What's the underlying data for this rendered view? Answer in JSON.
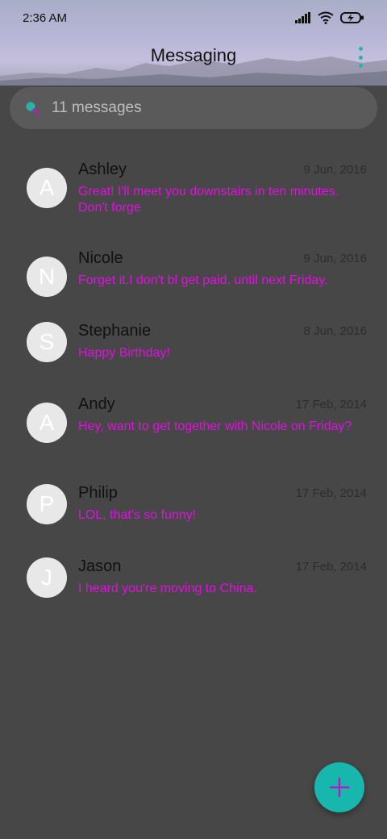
{
  "status_bar": {
    "time": "2:36 AM",
    "icons": [
      "signal-icon",
      "wifi-icon",
      "battery-charging-icon"
    ]
  },
  "app_bar": {
    "title": "Messaging",
    "menu_icon": "more-vert-icon"
  },
  "search": {
    "placeholder": "11 messages",
    "icon": "search-icon"
  },
  "conversations": [
    {
      "initial": "A",
      "name": "Ashley",
      "date": "9 Jun, 2016",
      "snippet": "Great! I'll meet you downstairs in ten minutes. Don't forge"
    },
    {
      "initial": "N",
      "name": "Nicole",
      "date": "9 Jun, 2016",
      "snippet": "Forget it.I don't bl get paid. until next Friday."
    },
    {
      "initial": "S",
      "name": "Stephanie",
      "date": "8 Jun, 2016",
      "snippet": "Happy Birthday!"
    },
    {
      "initial": "A",
      "name": "Andy",
      "date": "17 Feb, 2014",
      "snippet": "Hey, want to get together with Nicole on Friday?"
    },
    {
      "initial": "P",
      "name": "Philip",
      "date": "17 Feb, 2014",
      "snippet": "LOL, that's so funny!"
    },
    {
      "initial": "J",
      "name": "Jason",
      "date": "17 Feb, 2014",
      "snippet": "I heard you're moving to China."
    }
  ],
  "fab": {
    "icon": "add-icon"
  },
  "colors": {
    "accent": "#18b7ad",
    "snippet": "#e010e0",
    "background": "#474747"
  }
}
